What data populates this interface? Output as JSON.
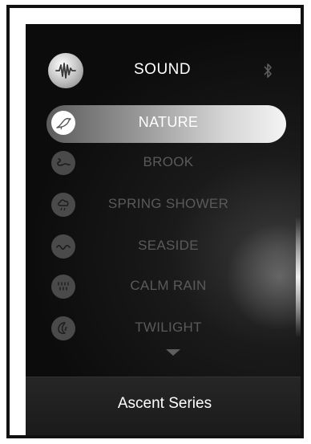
{
  "header": {
    "title": "SOUND",
    "icon": "sound-wave-icon",
    "status_icon": "bluetooth-icon"
  },
  "sound_list": {
    "items": [
      {
        "label": "NATURE",
        "icon": "bird-icon",
        "selected": true
      },
      {
        "label": "BROOK",
        "icon": "brook-icon",
        "selected": false
      },
      {
        "label": "SPRING SHOWER",
        "icon": "cloud-rain-icon",
        "selected": false
      },
      {
        "label": "SEASIDE",
        "icon": "waves-icon",
        "selected": false
      },
      {
        "label": "CALM RAIN",
        "icon": "rain-drops-icon",
        "selected": false
      },
      {
        "label": "TWILIGHT",
        "icon": "moon-icon",
        "selected": false
      }
    ],
    "more_indicator": "chevron-down-icon"
  },
  "footer": {
    "label": "Ascent Series"
  },
  "colors": {
    "background": "#0c0c0c",
    "selected_text": "#ffffff",
    "unselected_text": "#5a5a5a",
    "footer_background": "#1f1f1f"
  }
}
